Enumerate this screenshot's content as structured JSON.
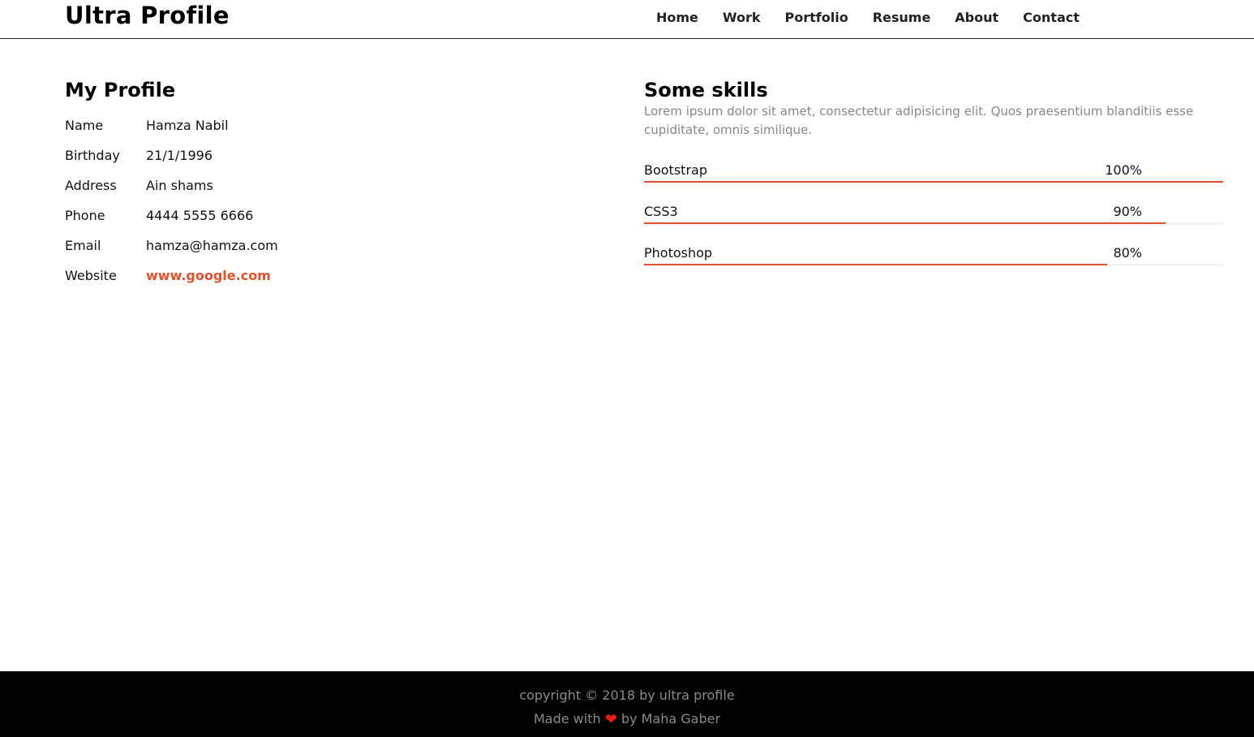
{
  "header": {
    "brand": "Ultra Profile",
    "nav": [
      "Home",
      "Work",
      "Portfolio",
      "Resume",
      "About",
      "Contact"
    ]
  },
  "profile": {
    "title": "My Profile",
    "rows": [
      {
        "label": "Name",
        "value": "Hamza Nabil"
      },
      {
        "label": "Birthday",
        "value": "21/1/1996"
      },
      {
        "label": "Address",
        "value": "Ain shams"
      },
      {
        "label": "Phone",
        "value": "4444 5555 6666"
      },
      {
        "label": "Email",
        "value": "hamza@hamza.com"
      },
      {
        "label": "Website",
        "value": "www.google.com"
      }
    ]
  },
  "skills": {
    "title": "Some skills",
    "description": "Lorem ipsum dolor sit amet, consectetur adipisicing elit. Quos praesentium blanditiis esse cupiditate, omnis similique.",
    "items": [
      {
        "name": "Bootstrap",
        "percent_label": "100%",
        "level": 1.0
      },
      {
        "name": "CSS3",
        "percent_label": "90%",
        "level": 0.9
      },
      {
        "name": "Photoshop",
        "percent_label": "80%",
        "level": 0.8
      }
    ]
  },
  "footer": {
    "copyright": "copyright © 2018 by ultra profile",
    "made_with": "Made with",
    "by": "by Maha Gaber",
    "heart_icon": "heart-icon"
  },
  "colors": {
    "accent": "#e0522e",
    "footer_bg": "#000000",
    "muted_text": "#888888",
    "heart": "#ff1a1a"
  }
}
